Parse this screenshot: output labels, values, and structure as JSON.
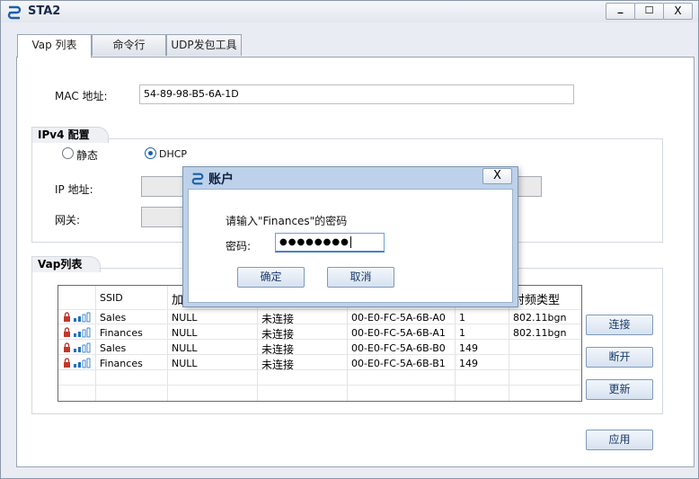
{
  "window": {
    "title": "STA2",
    "minimize": "_",
    "maximize": "☐",
    "close": "X"
  },
  "tabs": [
    {
      "label": "Vap 列表"
    },
    {
      "label": "命令行"
    },
    {
      "label": "UDP发包工具"
    }
  ],
  "mac": {
    "label": "MAC 地址:",
    "value": "54-89-98-B5-6A-1D"
  },
  "ipv4": {
    "title": "IPv4 配置",
    "static_label": "静态",
    "dhcp_label": "DHCP",
    "selected": "DHCP",
    "ip_label": "IP 地址:",
    "gateway_label": "网关:"
  },
  "vap": {
    "title": "Vap列表",
    "columns": [
      "SSID",
      "加",
      "",
      "",
      "",
      "射频类型"
    ],
    "rows": [
      {
        "ssid": "Sales",
        "enc": "NULL",
        "status": "未连接",
        "bssid": "00-E0-FC-5A-6B-A0",
        "channel": "1",
        "radio": "802.11bgn"
      },
      {
        "ssid": "Finances",
        "enc": "NULL",
        "status": "未连接",
        "bssid": "00-E0-FC-5A-6B-A1",
        "channel": "1",
        "radio": "802.11bgn"
      },
      {
        "ssid": "Sales",
        "enc": "NULL",
        "status": "未连接",
        "bssid": "00-E0-FC-5A-6B-B0",
        "channel": "149",
        "radio": ""
      },
      {
        "ssid": "Finances",
        "enc": "NULL",
        "status": "未连接",
        "bssid": "00-E0-FC-5A-6B-B1",
        "channel": "149",
        "radio": ""
      }
    ],
    "connect": "连接",
    "disconnect": "断开",
    "refresh": "更新"
  },
  "apply": "应用",
  "dialog": {
    "title": "账户",
    "close": "X",
    "prompt": "请输入\"Finances\"的密码",
    "password_label": "密码:",
    "password_value": "●●●●●●●●",
    "ok": "确定",
    "cancel": "取消"
  },
  "icons": [
    "app-icon",
    "lock-icon",
    "signal-icon"
  ]
}
